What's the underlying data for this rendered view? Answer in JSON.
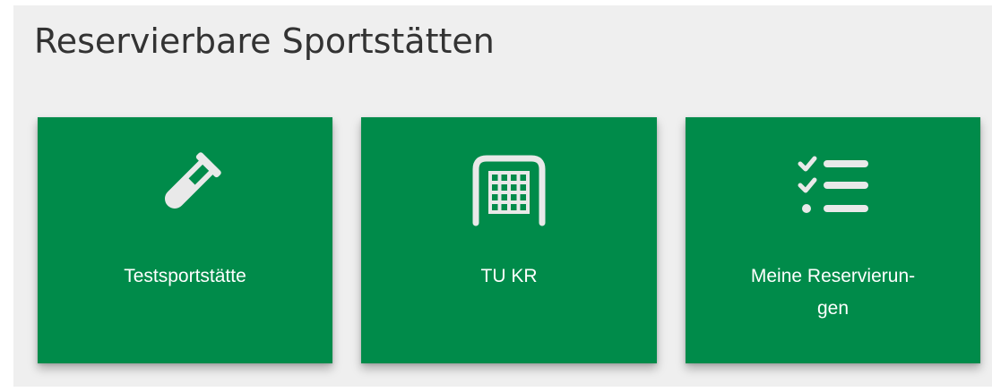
{
  "page": {
    "title": "Reservierbare Sportstätten"
  },
  "tiles": [
    {
      "label": "Testsportstätte",
      "icon": "test-tube-icon"
    },
    {
      "label": "TU KR",
      "icon": "goal-net-icon"
    },
    {
      "label_line1": "Meine Reservierun-",
      "label_line2": "gen",
      "icon": "checklist-icon"
    }
  ],
  "colors": {
    "tile_background": "#008b4a",
    "page_background": "#efefef",
    "title_text": "#333333",
    "tile_text": "#ffffff"
  }
}
